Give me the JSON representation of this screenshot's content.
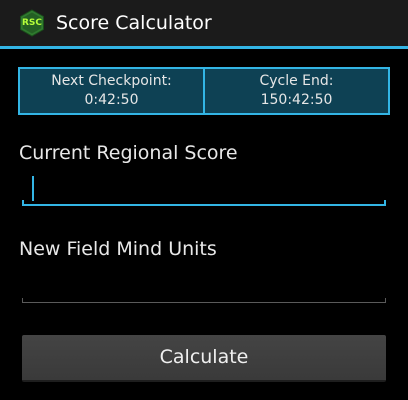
{
  "app": {
    "title": "Score Calculator",
    "icon_label": "RSC",
    "icon_name": "rsc-hexagon-icon",
    "colors": {
      "accent": "#33b5e5",
      "status_box_bg": "#0e4154",
      "icon_green": "#2f7a2f",
      "icon_text": "#b6ff3a"
    }
  },
  "status": {
    "checkpoint_label": "Next Checkpoint:",
    "checkpoint_value": "0:42:50",
    "cycle_label": "Cycle End:",
    "cycle_value": "150:42:50"
  },
  "form": {
    "score_label": "Current Regional Score",
    "score_value": "",
    "units_label": "New Field Mind Units",
    "units_value": "",
    "calculate_label": "Calculate"
  }
}
